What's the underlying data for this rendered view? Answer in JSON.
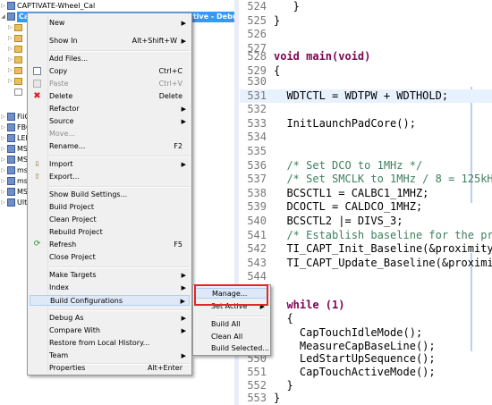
{
  "explorer": {
    "rows": [
      {
        "label": "CAPTIVATE-Wheel_Cal",
        "selected": false
      },
      {
        "label": "CapTouch_BoosterPack_UserExperience [Active - Debug]",
        "selected": true
      },
      {
        "label": "FiiO"
      },
      {
        "label": "FBO"
      },
      {
        "label": "LED"
      },
      {
        "label": "MSP"
      },
      {
        "label": "MSP"
      },
      {
        "label": "msp"
      },
      {
        "label": "msp"
      },
      {
        "label": "MSP"
      },
      {
        "label": "Ultra"
      }
    ]
  },
  "context_menu": {
    "items": [
      {
        "label": "New",
        "submenu": true
      },
      {
        "label": "Show In",
        "shortcut": "Alt+Shift+W",
        "submenu": true
      },
      {
        "label": "Add Files..."
      },
      {
        "label": "Copy",
        "shortcut": "Ctrl+C"
      },
      {
        "label": "Paste",
        "shortcut": "Ctrl+V",
        "disabled": true
      },
      {
        "label": "Delete",
        "shortcut": "Delete"
      },
      {
        "label": "Refactor",
        "submenu": true
      },
      {
        "label": "Source",
        "submenu": true
      },
      {
        "label": "Move...",
        "disabled": true
      },
      {
        "label": "Rename...",
        "shortcut": "F2"
      },
      {
        "label": "Import",
        "submenu": true
      },
      {
        "label": "Export..."
      },
      {
        "label": "Show Build Settings..."
      },
      {
        "label": "Build Project"
      },
      {
        "label": "Clean Project"
      },
      {
        "label": "Rebuild Project"
      },
      {
        "label": "Refresh",
        "shortcut": "F5"
      },
      {
        "label": "Close Project"
      },
      {
        "label": "Make Targets",
        "submenu": true
      },
      {
        "label": "Index",
        "submenu": true
      },
      {
        "label": "Build Configurations",
        "submenu": true
      },
      {
        "label": "Debug As",
        "submenu": true
      },
      {
        "label": "Compare With",
        "submenu": true
      },
      {
        "label": "Restore from Local History..."
      },
      {
        "label": "Team",
        "submenu": true
      },
      {
        "label": "Properties",
        "shortcut": "Alt+Enter"
      }
    ]
  },
  "submenu": {
    "items": [
      {
        "label": "Manage..."
      },
      {
        "label": "Set Active",
        "submenu": true
      },
      {
        "label": "Build All"
      },
      {
        "label": "Clean All"
      },
      {
        "label": "Build Selected..."
      }
    ]
  },
  "editor": {
    "lines": [
      {
        "num": "524",
        "text": "   }"
      },
      {
        "num": "525",
        "text": "}"
      },
      {
        "num": "526",
        "text": ""
      },
      {
        "num": "527",
        "text": ""
      },
      {
        "num": "528",
        "text": "void main(void)"
      },
      {
        "num": "529",
        "text": "{"
      },
      {
        "num": "530",
        "text": ""
      },
      {
        "num": "531",
        "text": "  WDTCTL = WDTPW + WDTHOLD;"
      },
      {
        "num": "532",
        "text": ""
      },
      {
        "num": "533",
        "text": "  InitLaunchPadCore();"
      },
      {
        "num": "534",
        "text": ""
      },
      {
        "num": "535",
        "text": ""
      },
      {
        "num": "536",
        "text": "  /* Set DCO to 1MHz */"
      },
      {
        "num": "537",
        "text": "  /* Set SMCLK to 1MHz / 8 = 125kH"
      },
      {
        "num": "538",
        "text": "  BCSCTL1 = CALBC1_1MHZ;"
      },
      {
        "num": "539",
        "text": "  DCOCTL = CALDCO_1MHZ;"
      },
      {
        "num": "540",
        "text": "  BCSCTL2 |= DIVS_3;"
      },
      {
        "num": "541",
        "text": "  /* Establish baseline for the pr"
      },
      {
        "num": "542",
        "text": "  TI_CAPT_Init_Baseline(&proximity"
      },
      {
        "num": "543",
        "text": "  TI_CAPT_Update_Baseline(&proximi"
      },
      {
        "num": "544",
        "text": ""
      },
      {
        "num": "545",
        "text": ""
      },
      {
        "num": "546",
        "text": "  while (1)"
      },
      {
        "num": "547",
        "text": "  {"
      },
      {
        "num": "548",
        "text": "    CapTouchIdleMode();"
      },
      {
        "num": "549",
        "text": ""
      },
      {
        "num": "550",
        "text": "    MeasureCapBaseLine();"
      },
      {
        "num": "550",
        "text": "    LedStartUpSequence();"
      },
      {
        "num": "551",
        "text": "    CapTouchActiveMode();"
      },
      {
        "num": "552",
        "text": "  }"
      },
      {
        "num": "553",
        "text": "}"
      }
    ]
  },
  "colors": {
    "selection": "#3399ff",
    "highlight_box": "#e3262c",
    "keyword": "#7f0055",
    "comment": "#3f7f5f"
  },
  "icons": {
    "copy": "copy-icon",
    "paste": "paste-icon",
    "delete": "delete-icon",
    "import": "import-icon",
    "export": "export-icon",
    "refresh": "refresh-icon"
  }
}
